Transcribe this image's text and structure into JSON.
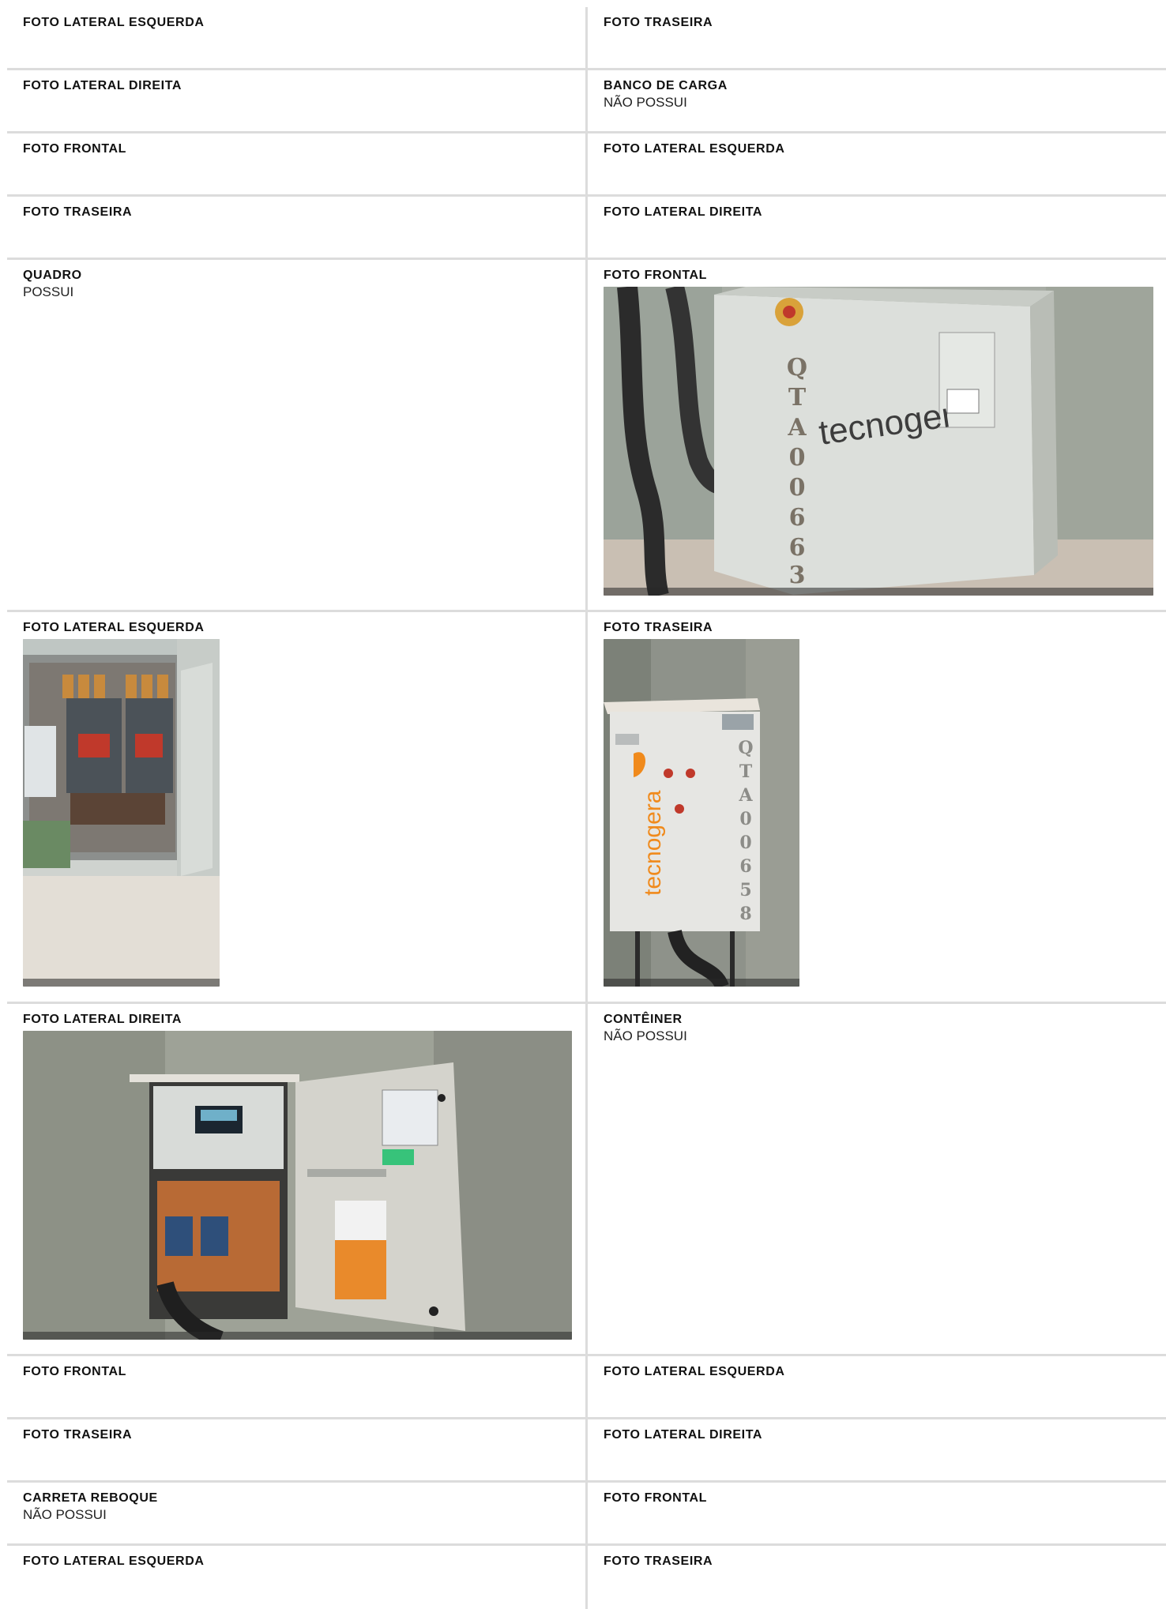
{
  "rows": [
    {
      "left": {
        "label": "FOTO LATERAL ESQUERDA",
        "value": ""
      },
      "right": {
        "label": "FOTO TRASEIRA",
        "value": ""
      }
    },
    {
      "left": {
        "label": "FOTO LATERAL DIREITA",
        "value": ""
      },
      "right": {
        "label": "BANCO DE CARGA",
        "value": "NÃO POSSUI"
      }
    },
    {
      "left": {
        "label": "FOTO FRONTAL",
        "value": ""
      },
      "right": {
        "label": "FOTO LATERAL ESQUERDA",
        "value": ""
      }
    },
    {
      "left": {
        "label": "FOTO TRASEIRA",
        "value": ""
      },
      "right": {
        "label": "FOTO LATERAL DIREITA",
        "value": ""
      }
    },
    {
      "left": {
        "label": "QUADRO",
        "value": "POSSUI"
      },
      "right": {
        "label": "FOTO FRONTAL",
        "value": ""
      }
    },
    {
      "left": {
        "label": "FOTO LATERAL ESQUERDA",
        "value": ""
      },
      "right": {
        "label": "FOTO TRASEIRA",
        "value": ""
      }
    },
    {
      "left": {
        "label": "FOTO LATERAL DIREITA",
        "value": ""
      },
      "right": {
        "label": "CONTÊINER",
        "value": "NÃO POSSUI"
      }
    },
    {
      "left": {
        "label": "FOTO FRONTAL",
        "value": ""
      },
      "right": {
        "label": "FOTO LATERAL ESQUERDA",
        "value": ""
      }
    },
    {
      "left": {
        "label": "FOTO TRASEIRA",
        "value": ""
      },
      "right": {
        "label": "FOTO LATERAL DIREITA",
        "value": ""
      }
    },
    {
      "left": {
        "label": "CARRETA REBOQUE",
        "value": "NÃO POSSUI"
      },
      "right": {
        "label": "FOTO FRONTAL",
        "value": ""
      }
    },
    {
      "left": {
        "label": "FOTO LATERAL ESQUERDA",
        "value": ""
      },
      "right": {
        "label": "FOTO TRASEIRA",
        "value": ""
      }
    }
  ],
  "photos": {
    "frontal": {
      "brand": "tecnoger",
      "stencil": [
        "Q",
        "T",
        "A",
        "0",
        "0",
        "6",
        "6",
        "3"
      ]
    },
    "traseira": {
      "brand": "tecnogera",
      "stencil": [
        "Q",
        "T",
        "A",
        "0",
        "0",
        "6",
        "5",
        "8"
      ]
    }
  }
}
